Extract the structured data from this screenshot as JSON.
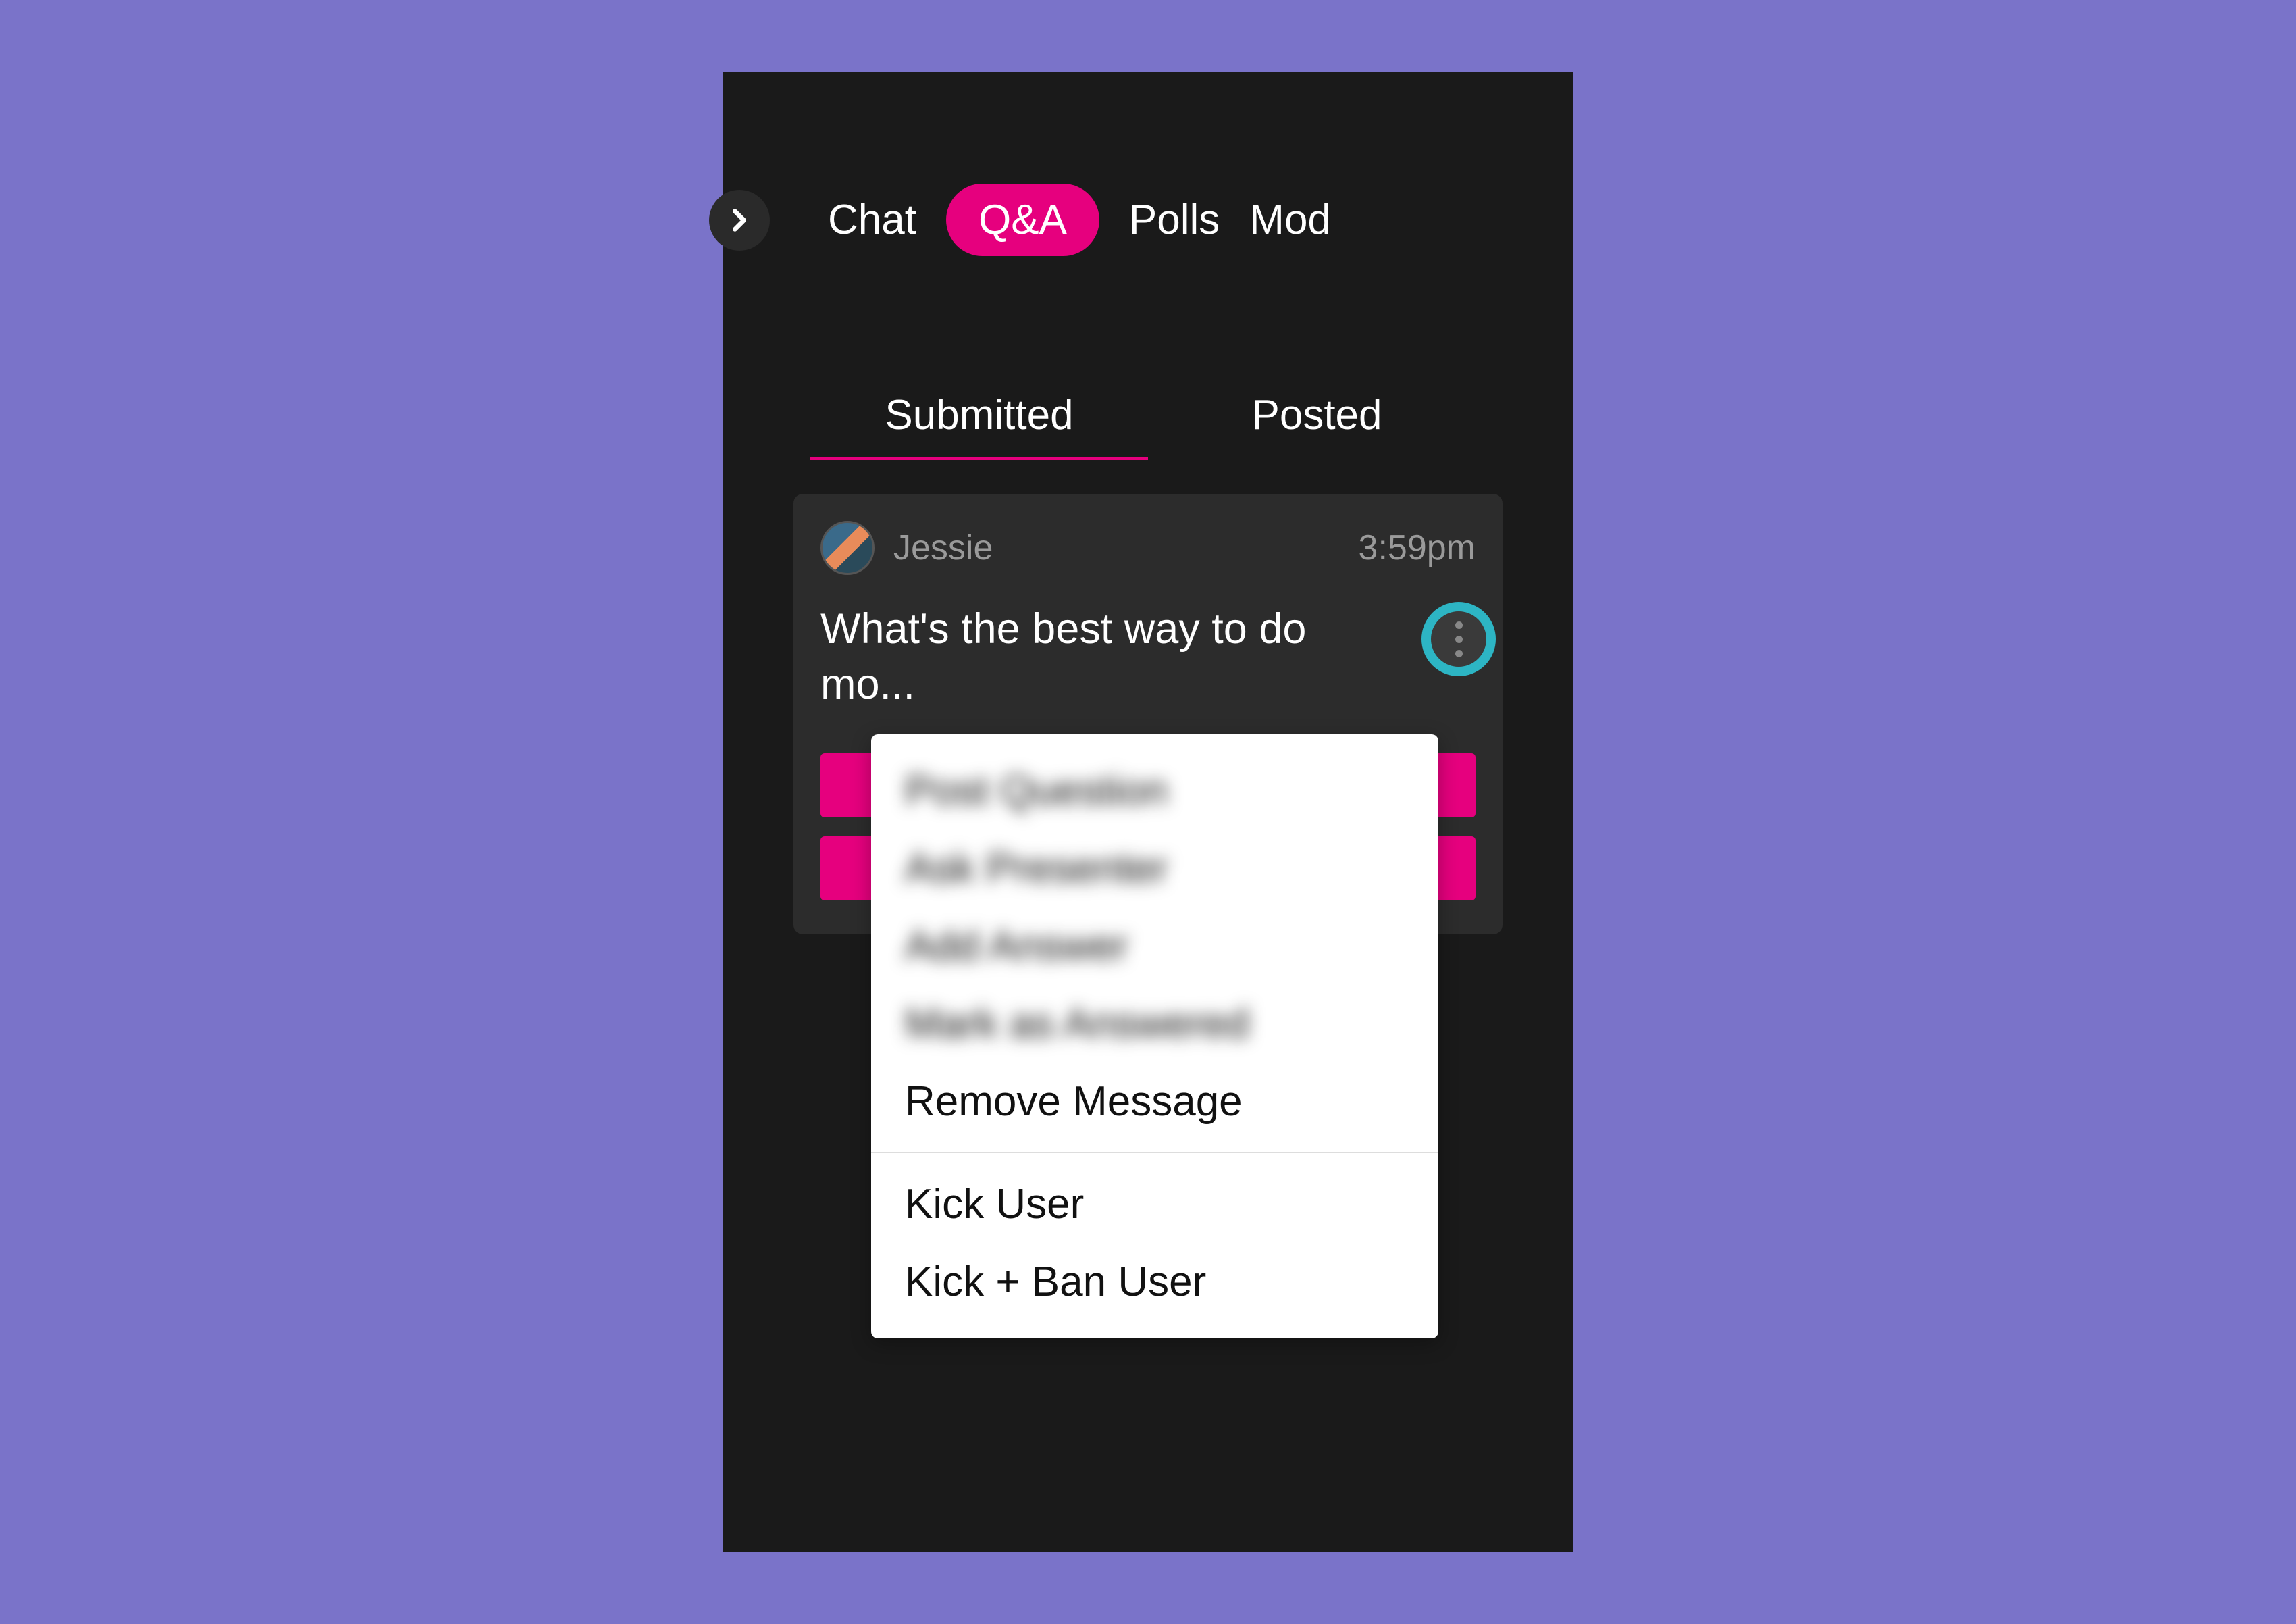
{
  "main_tabs": {
    "items": [
      "Chat",
      "Q&A",
      "Polls",
      "Mod"
    ],
    "active_index": 1
  },
  "sub_tabs": {
    "items": [
      "Submitted",
      "Posted"
    ],
    "active_index": 0
  },
  "question": {
    "author": "Jessie",
    "time": "3:59pm",
    "text": "What's the best way to do mo..."
  },
  "menu": {
    "blurred_items": [
      "Post Question",
      "Ask Presenter",
      "Add Answer",
      "Mark as Answered"
    ],
    "items_group1": [
      "Remove Message"
    ],
    "items_group2": [
      "Kick User",
      "Kick + Ban User"
    ]
  }
}
